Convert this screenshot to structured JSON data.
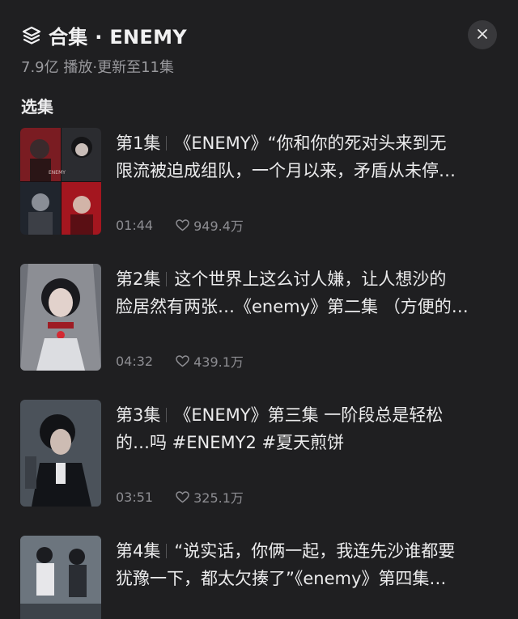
{
  "header": {
    "title": "合集 · ENEMY",
    "meta": "7.9亿 播放·更新至11集",
    "section_title": "选集",
    "stack_icon": "stack-layers-icon",
    "close_icon": "close-icon"
  },
  "episodes": [
    {
      "label": "第1集",
      "line1": "《ENEMY》“你和你的死对头来到无",
      "line2": "限流被迫成组队，一个月以来，矛盾从未停…",
      "duration": "01:44",
      "likes": "949.4万"
    },
    {
      "label": "第2集",
      "line1": "这个世界上这么讨人嫌，让人想沙的",
      "line2": "脸居然有两张…《enemy》第二集 （方便的…",
      "duration": "04:32",
      "likes": "439.1万"
    },
    {
      "label": "第3集",
      "line1": "《ENEMY》第三集 一阶段总是轻松",
      "line2": "的…吗 #ENEMY2 #夏天煎饼",
      "duration": "03:51",
      "likes": "325.1万"
    },
    {
      "label": "第4集",
      "line1": "“说实话，你俩一起，我连先沙谁都要",
      "line2": "犹豫一下，都太欠揍了”《enemy》第四集…",
      "duration": "",
      "likes": ""
    }
  ],
  "colors": {
    "background": "#1f1f21",
    "text": "#ececed",
    "muted": "#8d8d92",
    "accent_red": "#c4202a"
  }
}
